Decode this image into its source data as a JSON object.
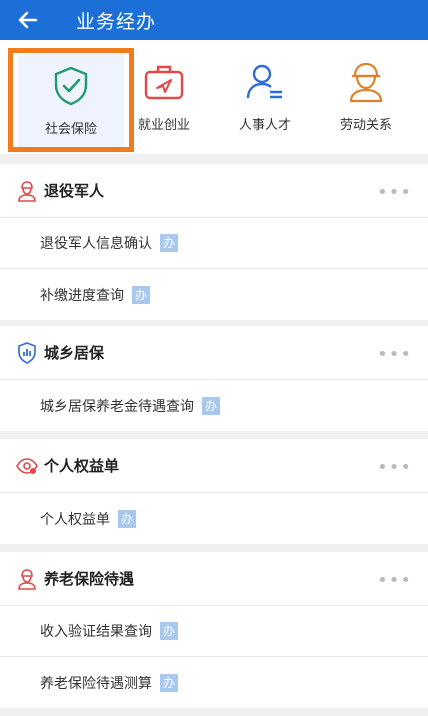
{
  "header": {
    "title": "业务经办",
    "back_icon": "arrow-left-icon"
  },
  "categories": [
    {
      "label": "社会保险",
      "icon": "shield-check-icon",
      "color": "#1f9a6a",
      "selected": true
    },
    {
      "label": "就业创业",
      "icon": "briefcase-send-icon",
      "color": "#e24a4a"
    },
    {
      "label": "人事人才",
      "icon": "person-list-icon",
      "color": "#2f6bd6"
    },
    {
      "label": "劳动关系",
      "icon": "worker-icon",
      "color": "#e0802a"
    }
  ],
  "sections": [
    {
      "title": "退役军人",
      "icon": "soldier-icon",
      "more": "•••",
      "items": [
        {
          "label": "退役军人信息确认",
          "badge": "办"
        },
        {
          "label": "补缴进度查询",
          "badge": "办"
        }
      ]
    },
    {
      "title": "城乡居保",
      "icon": "shield-chart-icon",
      "more": "•••",
      "items": [
        {
          "label": "城乡居保养老金待遇查询",
          "badge": "办"
        }
      ]
    },
    {
      "title": "个人权益单",
      "icon": "eye-check-icon",
      "more": "•••",
      "items": [
        {
          "label": "个人权益单",
          "badge": "办"
        }
      ]
    },
    {
      "title": "养老保险待遇",
      "icon": "soldier-icon",
      "more": "•••",
      "items": [
        {
          "label": "收入验证结果查询",
          "badge": "办"
        },
        {
          "label": "养老保险待遇测算",
          "badge": "办"
        }
      ]
    }
  ]
}
